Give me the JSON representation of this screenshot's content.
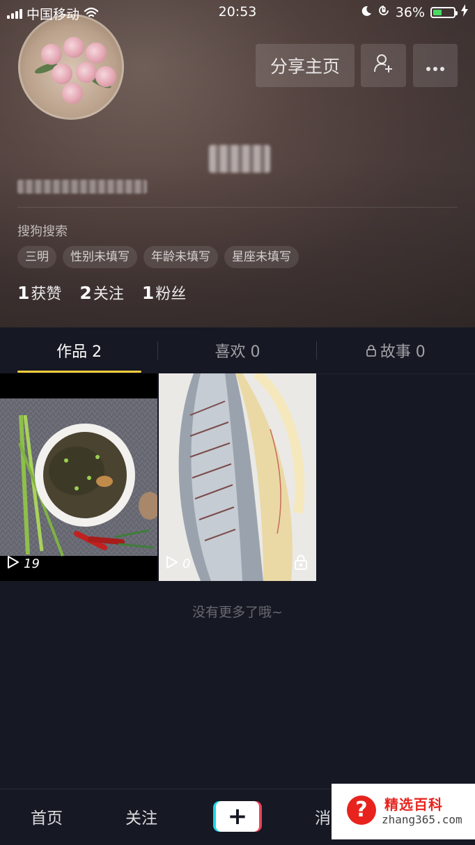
{
  "status_bar": {
    "carrier": "中国移动",
    "time": "20:53",
    "battery": "36%",
    "battery_level": 0.36
  },
  "profile": {
    "share_button": "分享主页",
    "add_friend_icon": "add-user-icon",
    "more_icon": "more-dots-icon",
    "signature": "搜狗搜索",
    "tags": [
      "三明",
      "性别未填写",
      "年龄未填写",
      "星座未填写"
    ],
    "stats": [
      {
        "count": "1",
        "label": "获赞"
      },
      {
        "count": "2",
        "label": "关注"
      },
      {
        "count": "1",
        "label": "粉丝"
      }
    ]
  },
  "tabs": [
    {
      "label": "作品 2"
    },
    {
      "label": "喜欢 0"
    },
    {
      "label": "故事 0"
    }
  ],
  "videos": [
    {
      "plays": "19"
    },
    {
      "plays": "0"
    }
  ],
  "no_more_text": "没有更多了哦~",
  "bottom_nav": {
    "home": "首页",
    "following": "关注",
    "plus": "+",
    "messages": "消"
  },
  "watermark": {
    "title": "精选百科",
    "url": "zhang365.com",
    "icon": "?"
  },
  "colors": {
    "tab_underline": "#facd3a",
    "battery_fill": "#4cd964",
    "plus_left": "#20d5ec",
    "plus_right": "#ea4359",
    "watermark_red": "#e8231e"
  }
}
